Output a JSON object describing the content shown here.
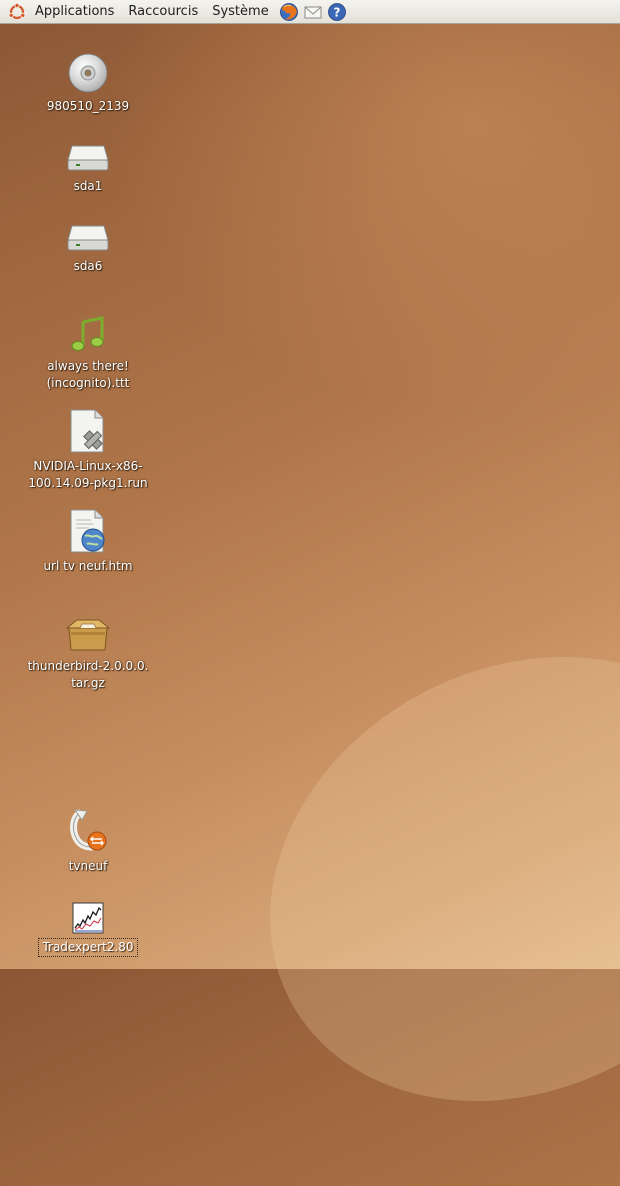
{
  "panel": {
    "menus": [
      "Applications",
      "Raccourcis",
      "Système"
    ],
    "launchers": [
      "firefox-icon",
      "mail-icon",
      "help-icon"
    ]
  },
  "desktop": {
    "icons": [
      {
        "label": "980510_2139",
        "icon": "cd-icon"
      },
      {
        "label": "sda1",
        "icon": "drive-icon"
      },
      {
        "label": "sda6",
        "icon": "drive-icon"
      },
      {
        "label": "always there!\n(incognito).ttt",
        "icon": "music-note-icon"
      },
      {
        "label": "NVIDIA-Linux-x86-\n100.14.09-pkg1.run",
        "icon": "executable-file-icon"
      },
      {
        "label": "url tv neuf.htm",
        "icon": "html-file-icon"
      },
      {
        "label": "thunderbird-2.0.0.0.\ntar.gz",
        "icon": "archive-icon"
      },
      {
        "label": "tvneuf",
        "icon": "symlink-icon"
      },
      {
        "label": "Tradexpert2.80",
        "icon": "chart-app-icon"
      }
    ]
  }
}
